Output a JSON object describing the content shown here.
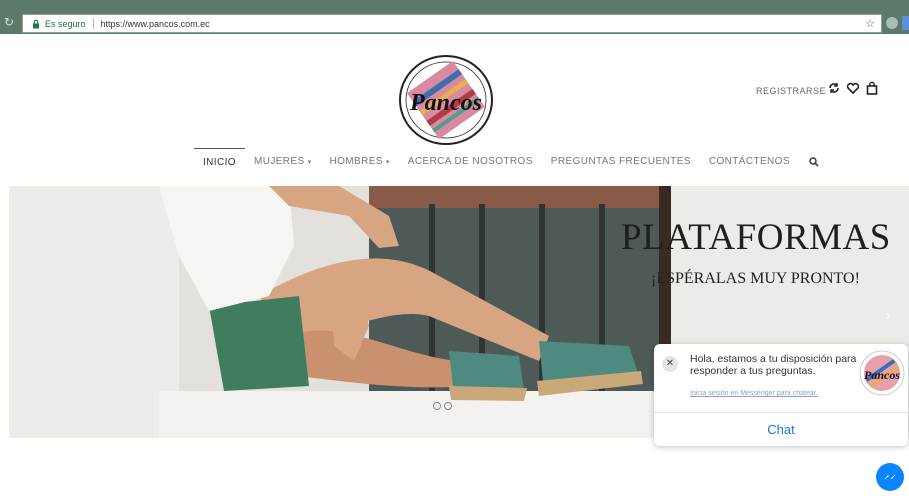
{
  "browser": {
    "secure_label": "Es seguro",
    "url": "https://www.pancos.com.ec"
  },
  "header": {
    "logo_text": "Pancos",
    "register_label": "REGISTRARSE"
  },
  "nav": {
    "items": [
      {
        "label": "INICIO",
        "caret": ""
      },
      {
        "label": "MUJERES",
        "caret": "▾"
      },
      {
        "label": "HOMBRES",
        "caret": "▾"
      },
      {
        "label": "ACERCA DE NOSOTROS",
        "caret": ""
      },
      {
        "label": "PREGUNTAS FRECUENTES",
        "caret": ""
      },
      {
        "label": "CONTÁCTENOS",
        "caret": ""
      }
    ]
  },
  "hero": {
    "title": "PLATAFORMAS",
    "subtitle": "¡ESPÉRALAS MUY PRONTO!",
    "next_icon": "chevron-right-icon"
  },
  "chat": {
    "message": "Hola, estamos a tu disposición para responder a tus preguntas.",
    "login_link": "Inicia sesión en Messenger para chatear.",
    "button_label": "Chat"
  },
  "colors": {
    "browser_bar": "#5c7a6a",
    "messenger_blue": "#0a84ff",
    "chat_link": "#1a73d6"
  }
}
